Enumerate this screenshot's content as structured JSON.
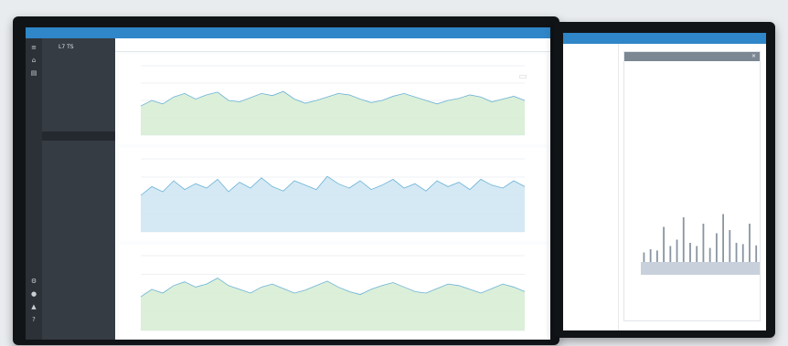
{
  "main": {
    "sidebar": {
      "title": "L7 TS",
      "subtitle": "",
      "items": [
        {
          "label": "",
          "active": false
        },
        {
          "label": "",
          "active": false
        },
        {
          "label": "",
          "active": false
        },
        {
          "label": "",
          "active": false
        },
        {
          "label": "",
          "active": true
        },
        {
          "label": "",
          "active": false
        },
        {
          "label": "",
          "active": false
        }
      ]
    },
    "tabs": [
      {
        "label": "",
        "active": true
      },
      {
        "label": "",
        "active": false
      },
      {
        "label": "",
        "active": false
      },
      {
        "label": "",
        "active": false
      }
    ],
    "panels": [
      {
        "title": "",
        "series": [
          0.42,
          0.5,
          0.45,
          0.55,
          0.6,
          0.52,
          0.58,
          0.62,
          0.5,
          0.48,
          0.54,
          0.6,
          0.57,
          0.63,
          0.52,
          0.46,
          0.5,
          0.55,
          0.6,
          0.58,
          0.52,
          0.47,
          0.5,
          0.56,
          0.6,
          0.55,
          0.5,
          0.45,
          0.5,
          0.53,
          0.58,
          0.55,
          0.48,
          0.52,
          0.56,
          0.5
        ]
      },
      {
        "title": "",
        "series": [
          0.5,
          0.62,
          0.55,
          0.7,
          0.58,
          0.66,
          0.6,
          0.72,
          0.55,
          0.68,
          0.6,
          0.74,
          0.62,
          0.56,
          0.7,
          0.64,
          0.58,
          0.76,
          0.66,
          0.6,
          0.7,
          0.58,
          0.64,
          0.72,
          0.6,
          0.66,
          0.56,
          0.7,
          0.62,
          0.68,
          0.58,
          0.72,
          0.64,
          0.6,
          0.7,
          0.62
        ]
      },
      {
        "title": "",
        "series": [
          0.45,
          0.55,
          0.5,
          0.6,
          0.65,
          0.58,
          0.62,
          0.7,
          0.6,
          0.55,
          0.5,
          0.58,
          0.62,
          0.56,
          0.5,
          0.54,
          0.6,
          0.66,
          0.58,
          0.52,
          0.48,
          0.55,
          0.6,
          0.64,
          0.58,
          0.52,
          0.5,
          0.56,
          0.62,
          0.6,
          0.55,
          0.5,
          0.56,
          0.62,
          0.58,
          0.52
        ]
      }
    ]
  },
  "second": {
    "panel": {
      "header": "",
      "lines": [
        "",
        ""
      ],
      "spikes": [
        0.15,
        0.2,
        0.18,
        0.55,
        0.25,
        0.35,
        0.7,
        0.3,
        0.25,
        0.6,
        0.22,
        0.45,
        0.75,
        0.5,
        0.3,
        0.28,
        0.6,
        0.26
      ]
    },
    "left_items": [
      {
        "label": "",
        "active": true
      },
      {
        "label": "",
        "active": false
      },
      {
        "label": "",
        "active": false
      },
      {
        "label": "",
        "active": false
      },
      {
        "label": "",
        "active": false
      },
      {
        "label": "",
        "active": false
      },
      {
        "label": "",
        "active": false
      }
    ]
  },
  "colors": {
    "accent": "#2f86c8",
    "area_fill": "#cfe7f3",
    "area_green": "#d7edd5",
    "line": "#6bb2d6",
    "sidebar": "#353c43",
    "bar": "#9aa9bd"
  },
  "icons": [
    "menu-icon",
    "home-icon",
    "chart-icon",
    "settings-icon",
    "user-icon",
    "alert-icon",
    "help-icon"
  ]
}
